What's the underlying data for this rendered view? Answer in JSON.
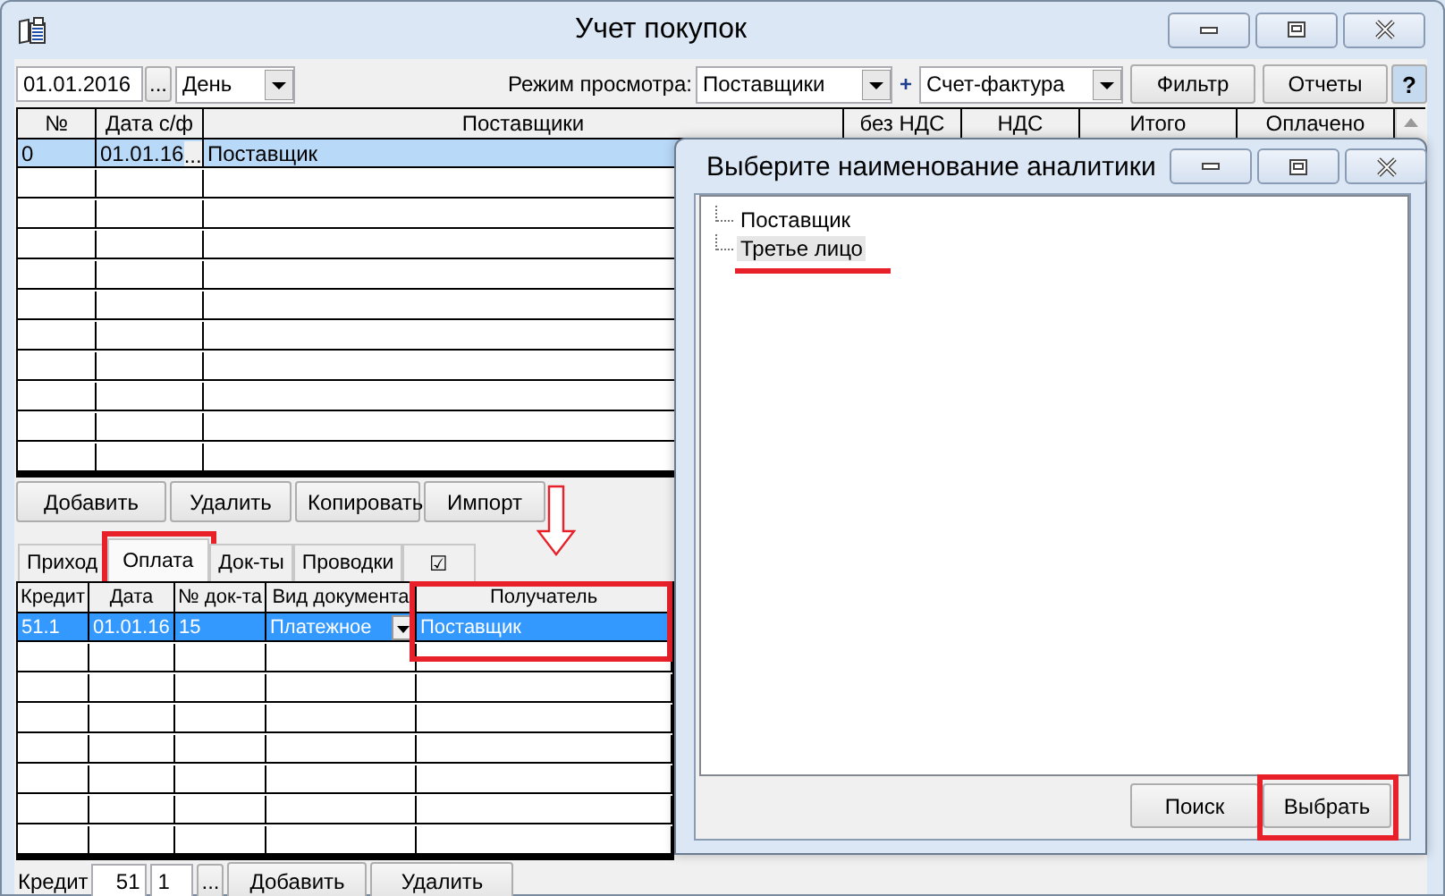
{
  "window": {
    "title": "Учет покупок"
  },
  "toolbar": {
    "date": "01.01.2016",
    "date_button": "...",
    "period": "День",
    "mode_label": "Режим просмотра:",
    "mode": "Поставщики",
    "plus": "+",
    "document": "Счет-фактура",
    "buttons": [
      "Фильтр",
      "Отчеты"
    ],
    "help": "?"
  },
  "invoices": {
    "columns": [
      {
        "label": "№"
      },
      {
        "label": "Дата с/ф"
      },
      {
        "label": "Поставщики"
      },
      {
        "label": "без НДС"
      },
      {
        "label": "НДС"
      },
      {
        "label": "Итого"
      },
      {
        "label": "Оплачено"
      }
    ],
    "rows": [
      {
        "cells": [
          "0",
          {
            "text": "01.01.16",
            "button": "..."
          },
          "Поставщик"
        ],
        "selected": true
      }
    ]
  },
  "invoice_buttons": [
    "Добавить",
    "Удалить",
    "Копировать",
    "Импорт"
  ],
  "tabs": [
    {
      "label": "Приход",
      "selected": false,
      "highlighted": false
    },
    {
      "label": "Оплата",
      "selected": true,
      "highlighted": true
    },
    {
      "label": "Док-ты",
      "selected": false,
      "highlighted": false
    },
    {
      "label": "Проводки",
      "selected": false,
      "highlighted": false
    },
    {
      "label": "☑",
      "selected": false,
      "highlighted": false
    }
  ],
  "payments": {
    "columns": [
      {
        "label": "Кредит"
      },
      {
        "label": "Дата"
      },
      {
        "label": "№ док-та"
      },
      {
        "label": "Вид документа"
      },
      {
        "label": "Получатель",
        "highlighted": true,
        "arrow": true
      }
    ],
    "rows": [
      {
        "cells": [
          "51.1",
          "01.01.16",
          "15",
          {
            "text": "Платежное",
            "kind": "dropdown"
          },
          "Поставщик"
        ],
        "selected": true
      }
    ]
  },
  "credit_bar": {
    "label": "Кредит",
    "account": "51",
    "subaccount": "1",
    "browse": "...",
    "buttons": [
      "Добавить",
      "Удалить"
    ]
  },
  "dialog": {
    "title": "Выберите наименование аналитики",
    "items": [
      {
        "label": "Поставщик",
        "selected": false,
        "underlined": false
      },
      {
        "label": "Третье лицо",
        "selected": true,
        "underlined": true
      }
    ],
    "buttons": [
      {
        "label": "Поиск",
        "highlighted": false
      },
      {
        "label": "Выбрать",
        "highlighted": true
      }
    ]
  }
}
